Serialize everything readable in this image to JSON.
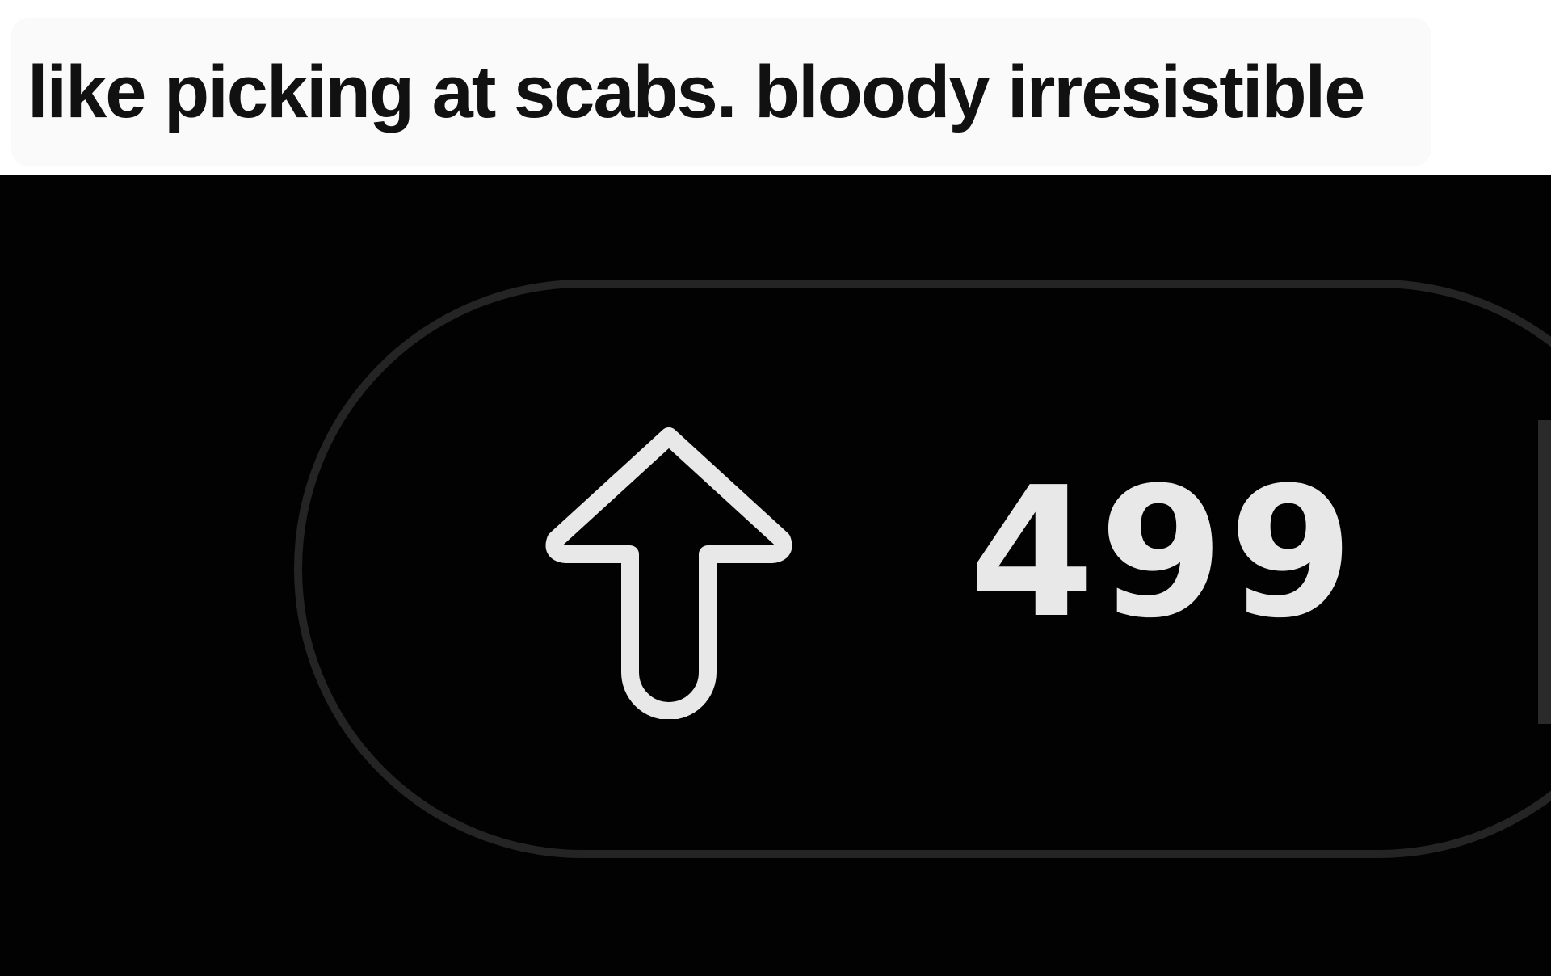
{
  "caption": {
    "text": "like picking at scabs. bloody irresistible"
  },
  "vote": {
    "icon": "upvote-arrow-outline-icon",
    "count": "499"
  },
  "colors": {
    "caption_background": "#fafafa",
    "caption_text": "#111111",
    "panel_background": "#020202",
    "pill_border": "#242424",
    "icon_and_count": "#e8e8e8"
  }
}
